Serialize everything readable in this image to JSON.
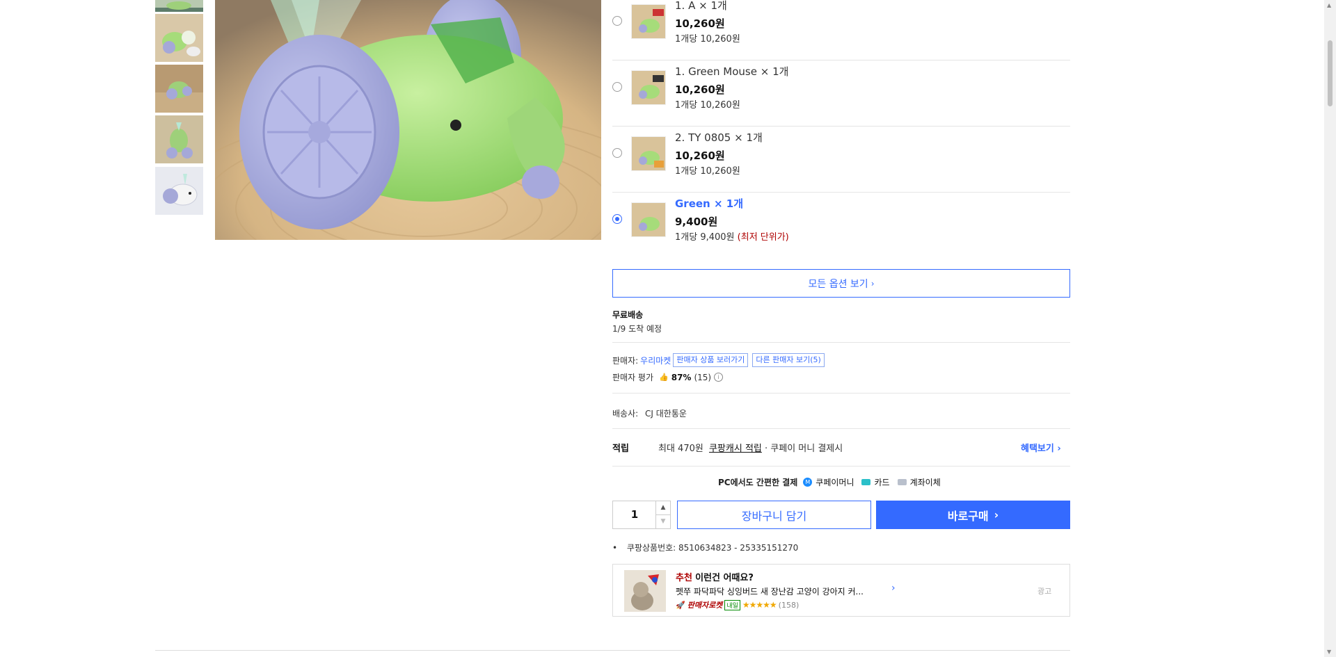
{
  "options": [
    {
      "name": "1. A",
      "qty": "× 1개",
      "price": "10,260원",
      "unit_prefix": "1개당",
      "unit_price": "10,260원",
      "selected": false,
      "lowest": ""
    },
    {
      "name": "1. Green Mouse",
      "qty": "× 1개",
      "price": "10,260원",
      "unit_prefix": "1개당",
      "unit_price": "10,260원",
      "selected": false,
      "lowest": ""
    },
    {
      "name": "2. TY 0805",
      "qty": "× 1개",
      "price": "10,260원",
      "unit_prefix": "1개당",
      "unit_price": "10,260원",
      "selected": false,
      "lowest": ""
    },
    {
      "name": "Green",
      "qty": "× 1개",
      "price": "9,400원",
      "unit_prefix": "1개당",
      "unit_price": "9,400원",
      "selected": true,
      "lowest": "(최저 단위가)"
    }
  ],
  "all_options_label": "모든 옵션 보기",
  "shipping": {
    "title": "무료배송",
    "arrival": "1/9 도착 예정"
  },
  "seller": {
    "label": "판매자:",
    "name": "우리마켓",
    "goto_label": "판매자 상품 보러가기",
    "other_label": "다른 판매자 보기(5)",
    "rating_label": "판매자 평가",
    "rating_pct": "87%",
    "rating_count": "(15)"
  },
  "carrier": {
    "label": "배송사:",
    "name": "CJ 대한통운"
  },
  "reward": {
    "title": "적립",
    "max": "최대 470원",
    "cash_label": "쿠팡캐시 적립",
    "pay_text": "· 쿠페이 머니 결제시",
    "benefit_label": "혜택보기"
  },
  "payment": {
    "title": "PC에서도 간편한 결제",
    "methods": [
      "쿠페이머니",
      "카드",
      "계좌이체"
    ]
  },
  "quantity": "1",
  "cart_label": "장바구니 담기",
  "buy_label": "바로구매",
  "product_no": "쿠팡상품번호: 8510634823 - 25335151270",
  "recommend": {
    "prefix": "추천",
    "title": "이런건 어때요?",
    "desc": "펫쭈 파닥파닥 싱잉버드 새 장난감 고양이 강아지 커...",
    "badge": "판매자로켓",
    "badge2": "내일",
    "rating": 5,
    "count": "(158)",
    "ad": "광고"
  },
  "colors": {
    "accent": "#346aff",
    "lowest": "#ae0000"
  }
}
